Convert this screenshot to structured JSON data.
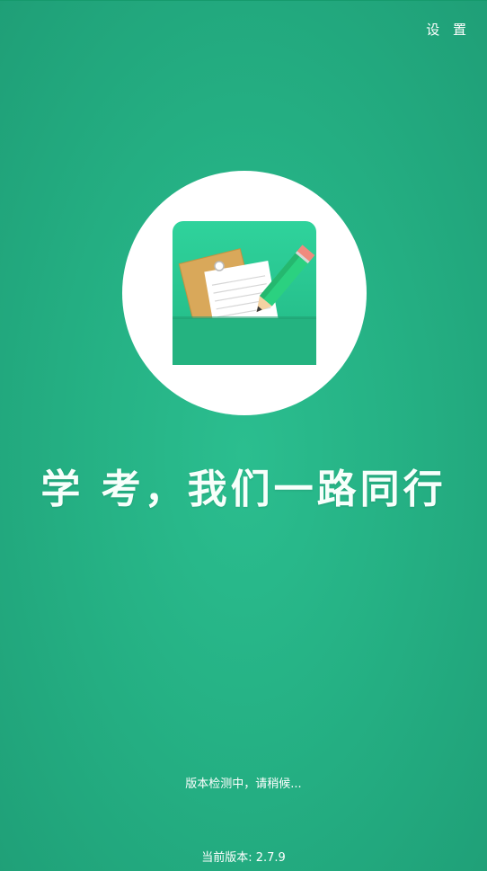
{
  "header": {
    "settings_label": "设 置"
  },
  "logo": {
    "icon": "notebook-pencil-icon",
    "tile_color": "#27c48d",
    "pocket_color": "#22b281"
  },
  "slogan": "学 考，我们一路同行",
  "status": {
    "message": "版本检测中，请稍候..."
  },
  "footer": {
    "version_label": "当前版本: ",
    "version_value": "2.7.9"
  },
  "colors": {
    "background": "#25b184",
    "circle": "#ffffff",
    "text": "#ffffff"
  }
}
